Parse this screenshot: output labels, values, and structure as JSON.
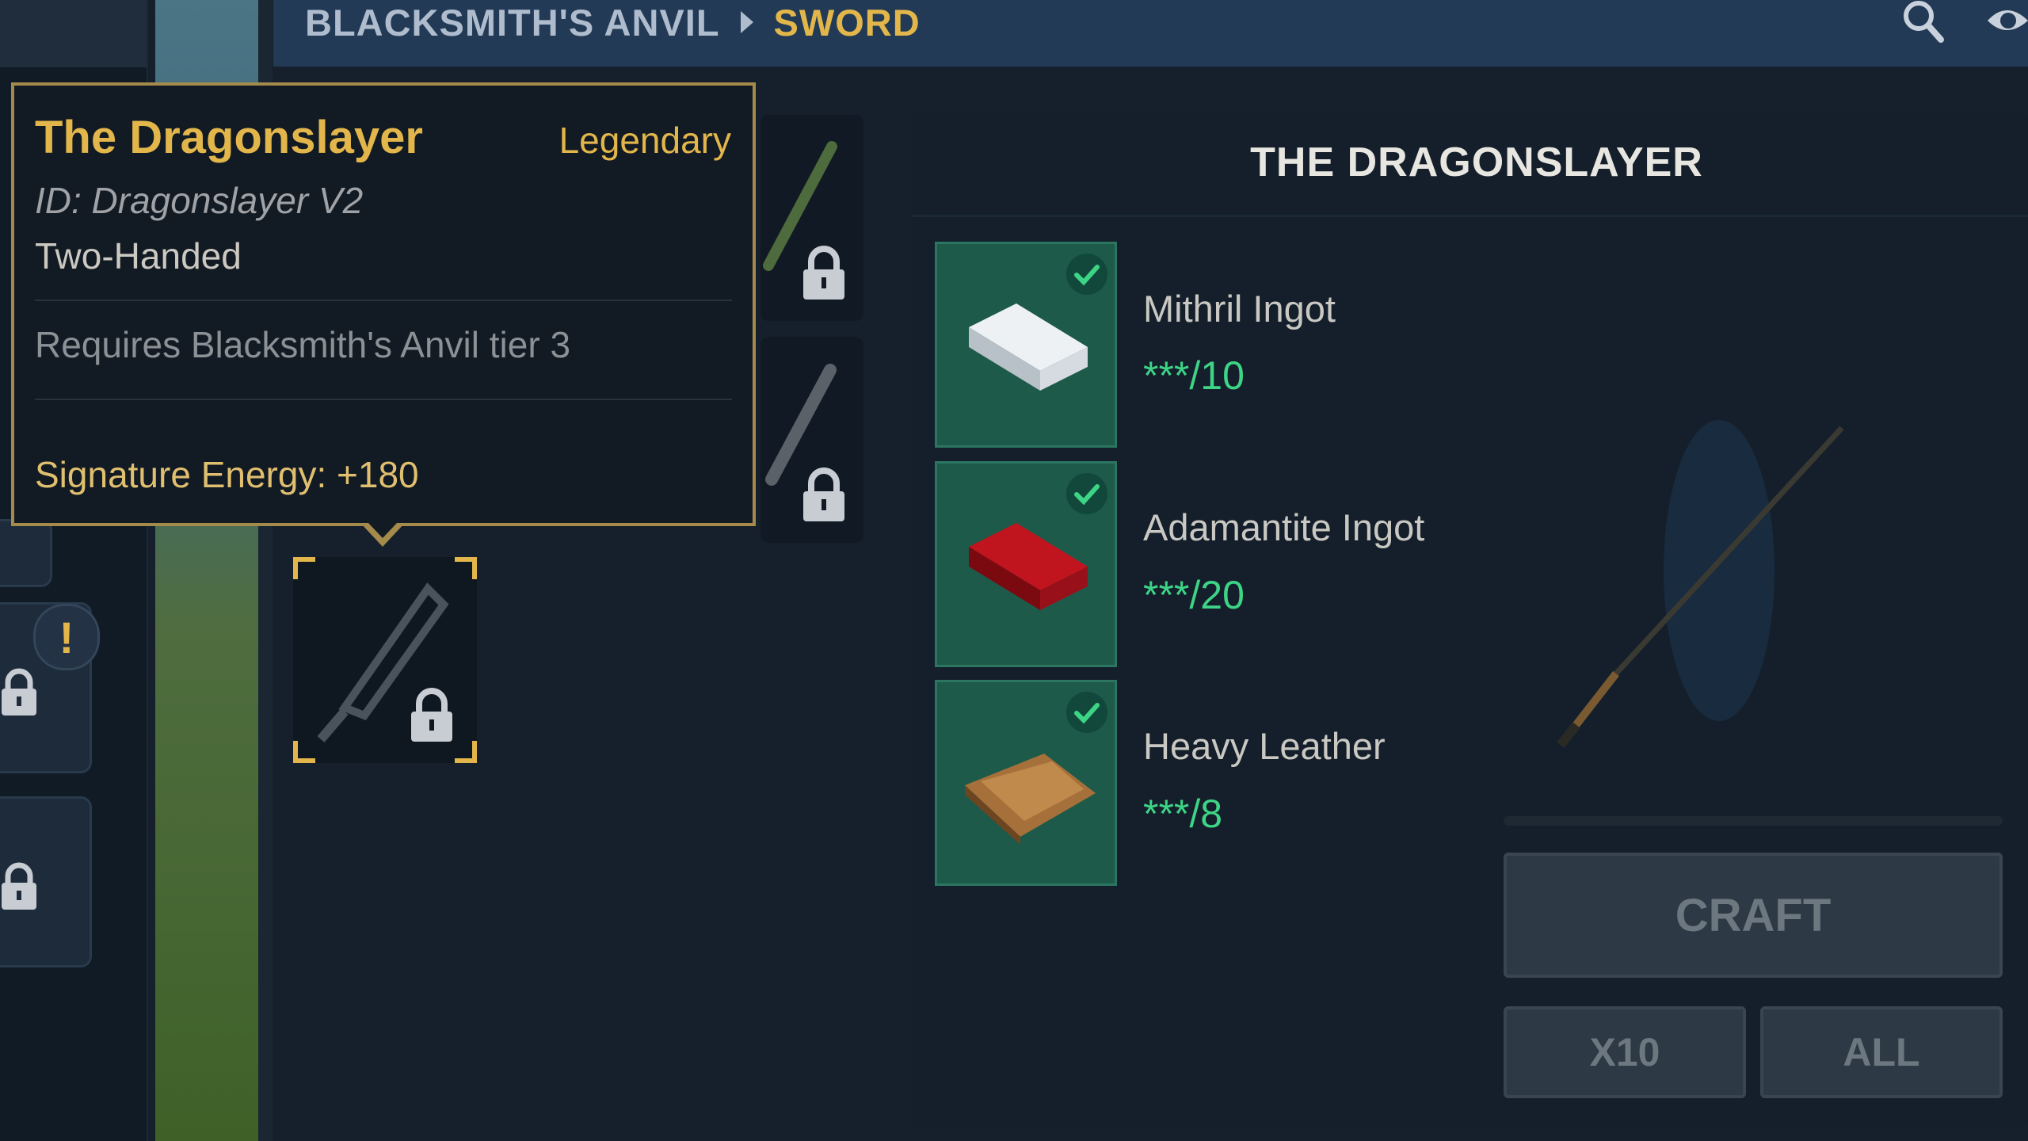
{
  "breadcrumb": {
    "root": "BLACKSMITH'S ANVIL",
    "current": "SWORD"
  },
  "icons": {
    "search": "search-icon",
    "eye": "eye-icon",
    "lock": "lock-icon",
    "alert": "alert-icon",
    "check": "check-icon"
  },
  "left_rail": {
    "alert_mark": "!"
  },
  "tooltip": {
    "name": "The Dragonslayer",
    "rarity": "Legendary",
    "id": "ID: Dragonslayer V2",
    "handedness": "Two-Handed",
    "requirement": "Requires Blacksmith's Anvil tier 3",
    "signature_energy": "Signature Energy: +180"
  },
  "detail": {
    "title": "THE DRAGONSLAYER",
    "ingredients": [
      {
        "name": "Mithril Ingot",
        "count": "***/10",
        "icon": "mithril-ingot-icon"
      },
      {
        "name": "Adamantite Ingot",
        "count": "***/20",
        "icon": "adamantite-ingot-icon"
      },
      {
        "name": "Heavy Leather",
        "count": "***/8",
        "icon": "heavy-leather-icon"
      }
    ]
  },
  "craft": {
    "craft_label": "CRAFT",
    "x10_label": "X10",
    "all_label": "ALL"
  },
  "colors": {
    "accent_gold": "#e2b64a",
    "count_green": "#3dd486",
    "tile_green": "#1d5a4a",
    "panel_bg": "#141f2b"
  }
}
